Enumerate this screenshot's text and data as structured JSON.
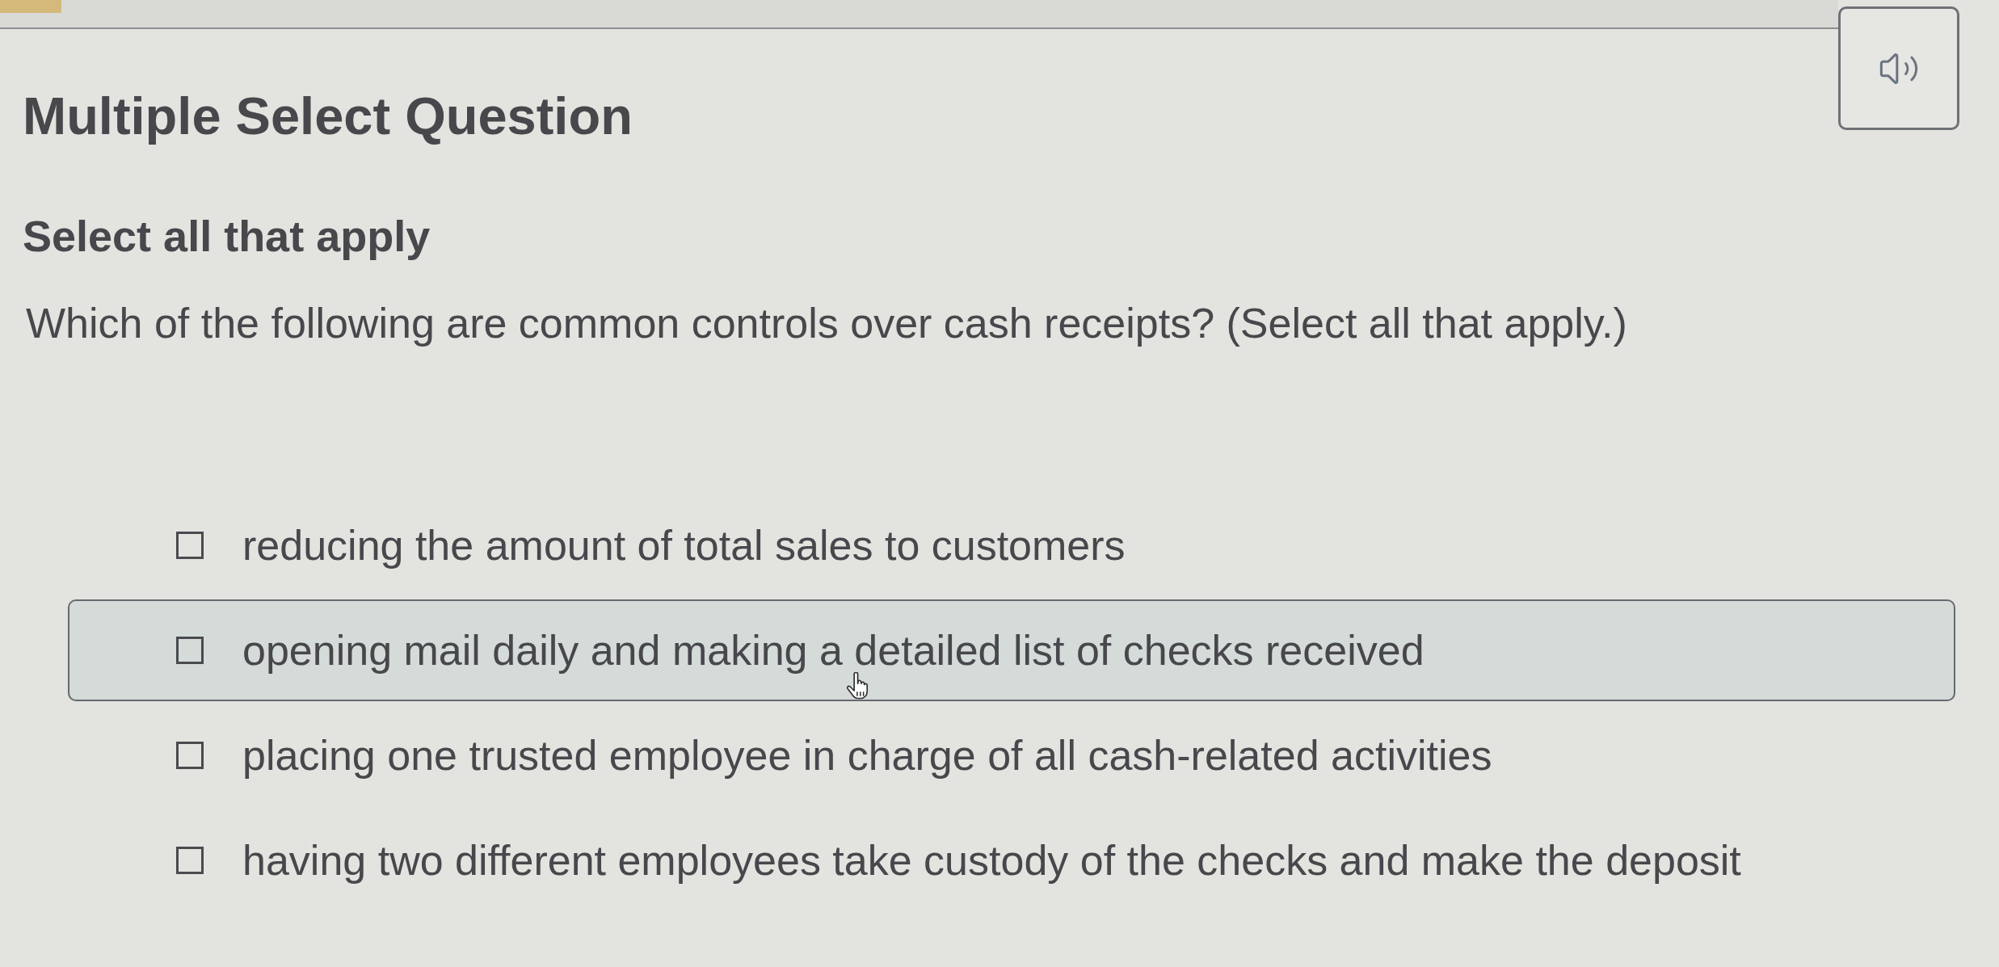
{
  "title": "Multiple Select Question",
  "instruction": "Select all that apply",
  "question": "Which of the following are common controls over cash receipts? (Select all that apply.)",
  "options": [
    {
      "label": "reducing the amount of total sales to customers",
      "checked": false,
      "hovered": false
    },
    {
      "label": "opening mail daily and making a detailed list of checks received",
      "checked": false,
      "hovered": true
    },
    {
      "label": "placing one trusted employee in charge of all cash-related activities",
      "checked": false,
      "hovered": false
    },
    {
      "label": "having two different employees take custody of the checks and make the deposit",
      "checked": false,
      "hovered": false
    }
  ]
}
